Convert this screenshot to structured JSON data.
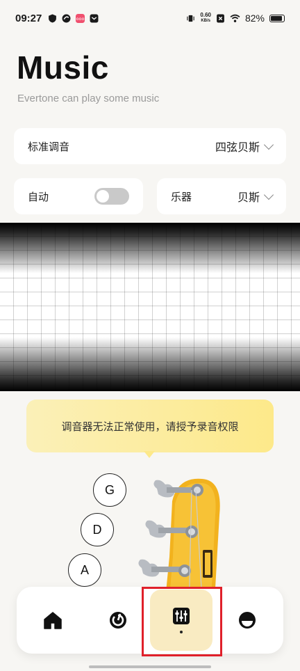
{
  "status_bar": {
    "time": "09:27",
    "net_speed_value": "0.60",
    "net_speed_unit": "KB/s",
    "battery": "82%"
  },
  "header": {
    "title": "Music",
    "subtitle": "Evertone can play some music"
  },
  "tuning": {
    "label": "标准调音",
    "value": "四弦贝斯"
  },
  "auto": {
    "label": "自动",
    "enabled": false
  },
  "instrument": {
    "label": "乐器",
    "value": "贝斯"
  },
  "permission_notice": "调音器无法正常使用，请授予录音权限",
  "strings": [
    "G",
    "D",
    "A"
  ],
  "nav": {
    "items": [
      {
        "icon": "home-icon"
      },
      {
        "icon": "metronome-icon"
      },
      {
        "icon": "tuner-icon",
        "active": true
      },
      {
        "icon": "profile-icon"
      }
    ]
  },
  "colors": {
    "accent_active": "#f9ebc2",
    "highlight": "#e0202a",
    "guitar_yellow": "#f2b21e"
  }
}
